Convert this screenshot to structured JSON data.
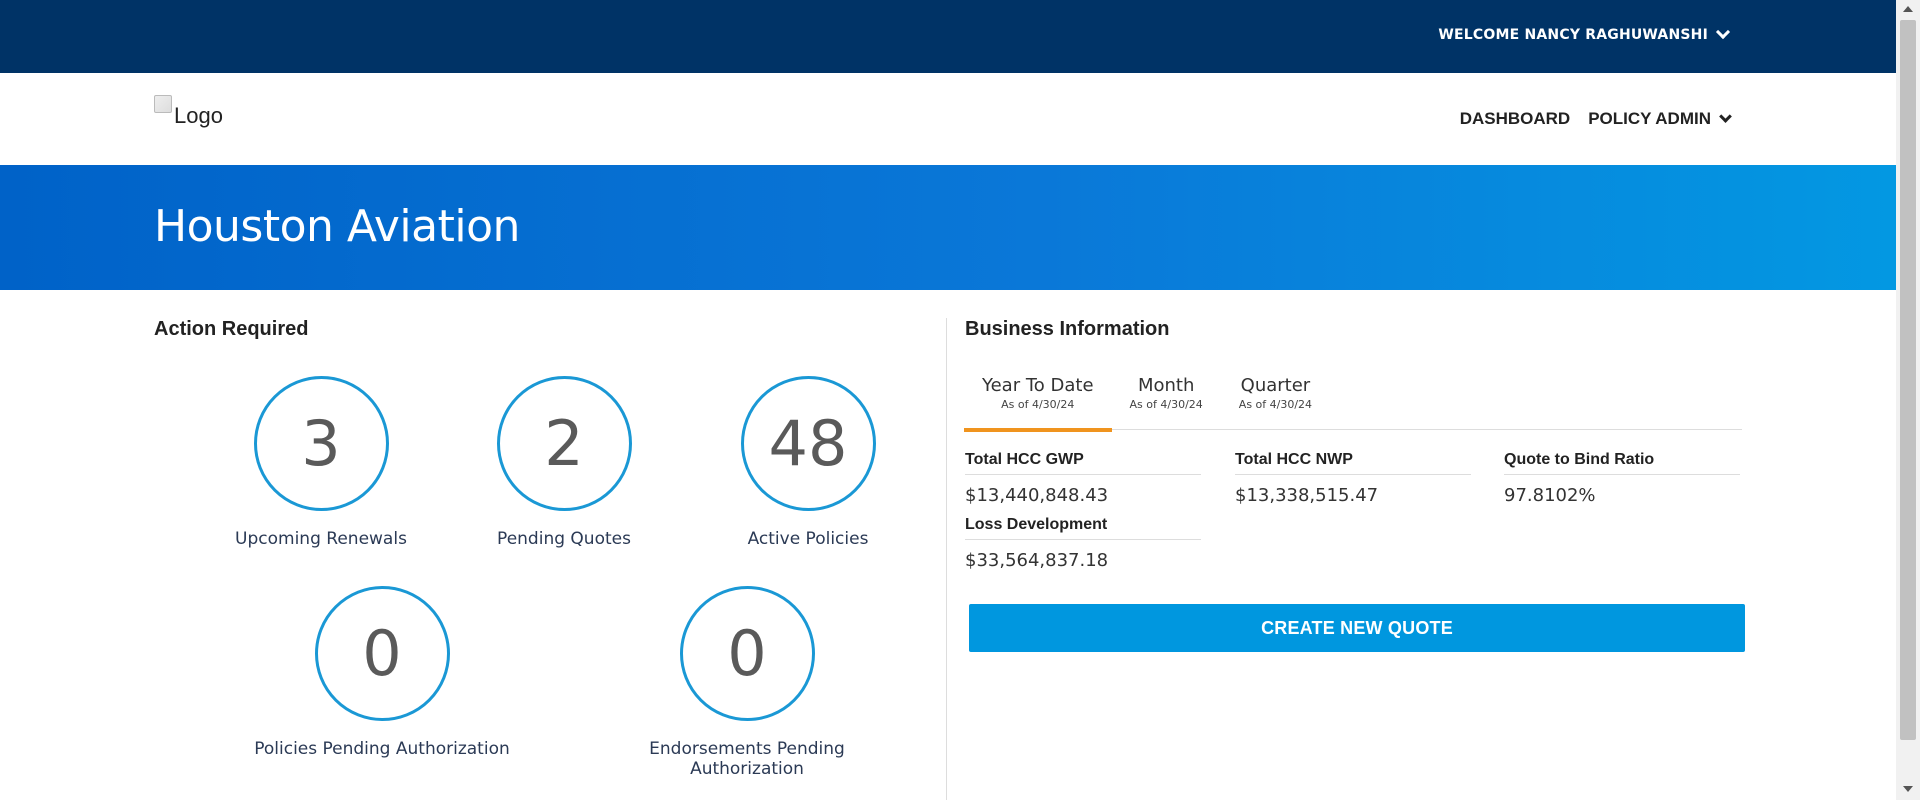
{
  "header": {
    "welcome_text": "WELCOME NANCY RAGHUWANSHI",
    "logo_alt": "Logo",
    "nav": {
      "dashboard": "DASHBOARD",
      "policy_admin": "POLICY ADMIN"
    }
  },
  "hero": {
    "title": "Houston Aviation"
  },
  "action_required": {
    "title": "Action Required",
    "stats": [
      {
        "value": "3",
        "label": "Upcoming Renewals"
      },
      {
        "value": "2",
        "label": "Pending Quotes"
      },
      {
        "value": "48",
        "label": "Active Policies"
      },
      {
        "value": "0",
        "label": "Policies Pending Authorization"
      },
      {
        "value": "0",
        "label": "Endorsements Pending Authorization"
      }
    ]
  },
  "business_info": {
    "title": "Business Information",
    "tabs": [
      {
        "label": "Year To Date",
        "sub": "As of 4/30/24",
        "active": true
      },
      {
        "label": "Month",
        "sub": "As of 4/30/24",
        "active": false
      },
      {
        "label": "Quarter",
        "sub": "As of 4/30/24",
        "active": false
      }
    ],
    "metrics": [
      {
        "label": "Total HCC GWP",
        "value": "$13,440,848.43"
      },
      {
        "label": "Total HCC NWP",
        "value": "$13,338,515.47"
      },
      {
        "label": "Quote to Bind Ratio",
        "value": "97.8102%"
      },
      {
        "label": "Loss Development",
        "value": "$33,564,837.18"
      }
    ],
    "create_button": "CREATE NEW QUOTE"
  },
  "colors": {
    "topbar": "#003366",
    "hero_start": "#0062c8",
    "hero_end": "#0398e2",
    "circle_border": "#1a98d5",
    "tab_active": "#f0941e",
    "button": "#0097df"
  }
}
